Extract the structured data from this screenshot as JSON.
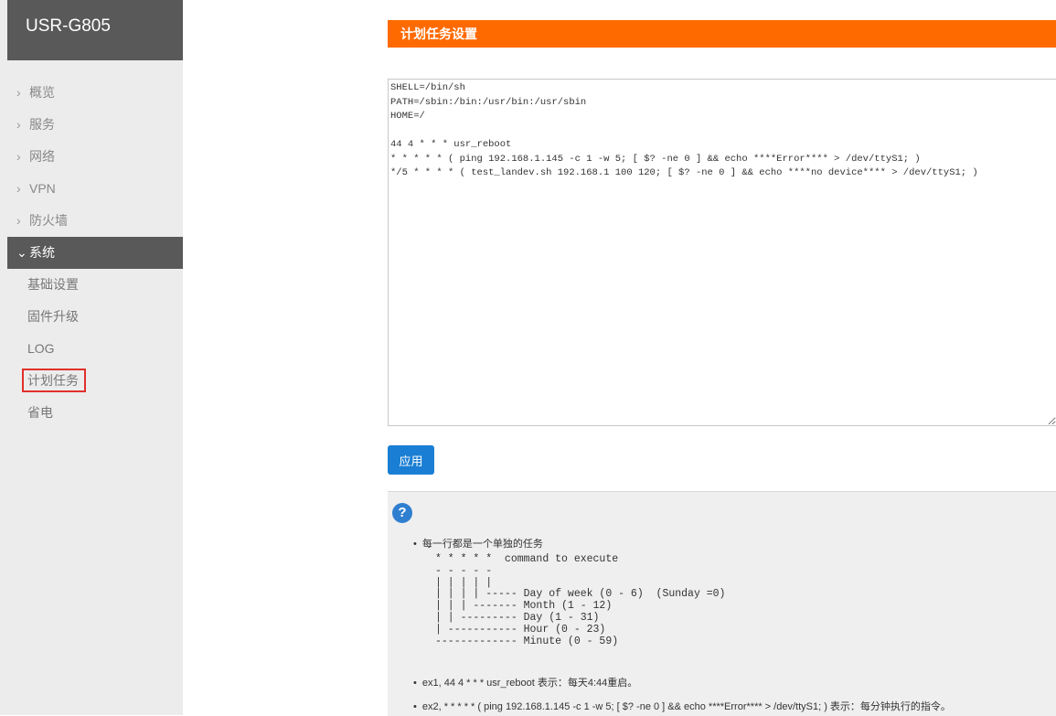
{
  "brand": "USR-G805",
  "nav": {
    "items": [
      {
        "label": "概览"
      },
      {
        "label": "服务"
      },
      {
        "label": "网络"
      },
      {
        "label": "VPN"
      },
      {
        "label": "防火墙"
      },
      {
        "label": "系统"
      }
    ],
    "sub_items": [
      {
        "label": "基础设置"
      },
      {
        "label": "固件升级"
      },
      {
        "label": "LOG"
      },
      {
        "label": "计划任务"
      },
      {
        "label": "省电"
      }
    ]
  },
  "main": {
    "title": "计划任务设置",
    "crontab": "SHELL=/bin/sh\nPATH=/sbin:/bin:/usr/bin:/usr/sbin\nHOME=/\n\n44 4 * * * usr_reboot\n* * * * * ( ping 192.168.1.145 -c 1 -w 5; [ $? -ne 0 ] && echo ****Error**** > /dev/ttyS1; )\n*/5 * * * * ( test_landev.sh 192.168.1 100 120; [ $? -ne 0 ] && echo ****no device**** > /dev/ttyS1; )",
    "apply_label": "应用",
    "help": {
      "icon": "?",
      "line1": "每一行都是一个单独的任务",
      "diagram": "* * * * *  command to execute\n- - - - -\n| | | | |\n| | | | ----- Day of week (0 - 6)  (Sunday =0)\n| | | ------- Month (1 - 12)\n| | --------- Day (1 - 31)\n| ----------- Hour (0 - 23)\n------------- Minute (0 - 59)",
      "ex1": "ex1,  44 4 * * * usr_reboot 表示：每天4:44重启。",
      "ex2": "ex2,  * * * * * ( ping 192.168.1.145 -c 1 -w 5; [ $? -ne 0 ] && echo ****Error**** > /dev/ttyS1; ) 表示：每分钟执行的指令。"
    }
  },
  "colors": {
    "accent": "#ff6a00",
    "button": "#1a7fd4",
    "highlight_box": "#e0302c"
  }
}
